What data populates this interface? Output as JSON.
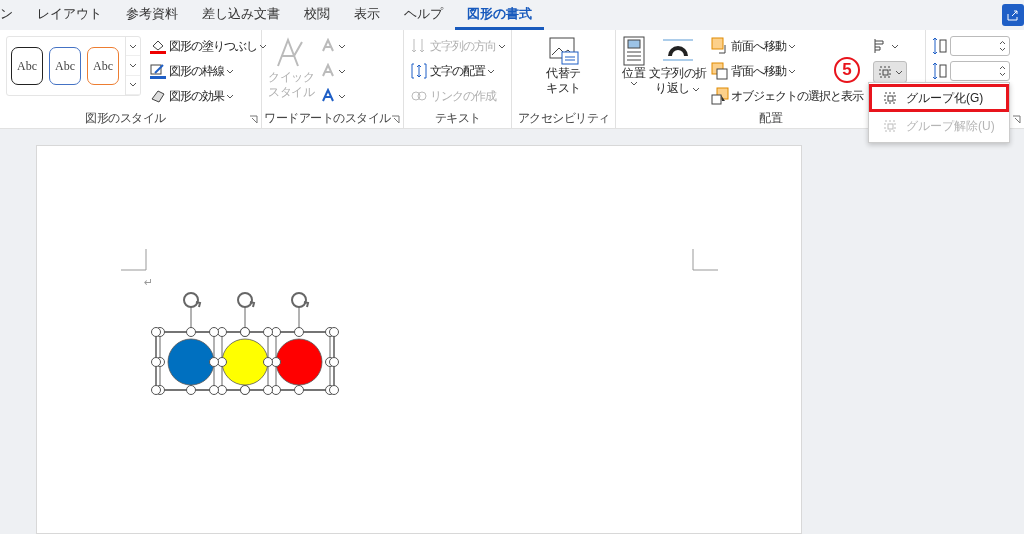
{
  "tabs": [
    {
      "label": "ン",
      "selected": false
    },
    {
      "label": "レイアウト",
      "selected": false
    },
    {
      "label": "参考資料",
      "selected": false
    },
    {
      "label": "差し込み文書",
      "selected": false
    },
    {
      "label": "校閲",
      "selected": false
    },
    {
      "label": "表示",
      "selected": false
    },
    {
      "label": "ヘルプ",
      "selected": false
    },
    {
      "label": "図形の書式",
      "selected": true
    }
  ],
  "shape_styles": {
    "gallery": [
      {
        "label": "Abc",
        "color": "#222222"
      },
      {
        "label": "Abc",
        "color": "#4472c4"
      },
      {
        "label": "Abc",
        "color": "#ed7d31"
      }
    ],
    "commands": [
      {
        "label": "図形の塗りつぶし",
        "kind": "fill",
        "disabled": false
      },
      {
        "label": "図形の枠線",
        "kind": "outline",
        "disabled": false
      },
      {
        "label": "図形の効果",
        "kind": "effects",
        "disabled": false
      }
    ],
    "label": "図形のスタイル"
  },
  "wordart": {
    "quick_style": {
      "line1": "クイック",
      "line2": "スタイル",
      "disabled": true
    },
    "label": "ワードアートのスタイル"
  },
  "text": {
    "commands": [
      {
        "label": "文字列の方向",
        "kind": "direction",
        "disabled": true
      },
      {
        "label": "文字の配置",
        "kind": "align",
        "disabled": false
      },
      {
        "label": "リンクの作成",
        "kind": "link",
        "disabled": true
      }
    ],
    "label": "テキスト"
  },
  "accessibility": {
    "button": {
      "line1": "代替テ",
      "line2": "キスト"
    },
    "label": "アクセシビリティ"
  },
  "arrange": {
    "position": {
      "label": "位置"
    },
    "wrap": {
      "line1": "文字列の折",
      "line2": "り返し"
    },
    "commands": [
      {
        "label": "前面へ移動",
        "kind": "front"
      },
      {
        "label": "背面へ移動",
        "kind": "back"
      },
      {
        "label": "オブジェクトの選択と表示",
        "kind": "pane"
      }
    ],
    "group_button": {
      "expanded": true
    },
    "label": "配置"
  },
  "annotation": {
    "label": "5"
  },
  "group_menu": [
    {
      "label": "グループ化(G)",
      "disabled": false,
      "highlighted": true
    },
    {
      "label": "グループ解除(U)",
      "disabled": true,
      "highlighted": false
    }
  ],
  "document": {
    "paragraph_mark": "↵",
    "shapes": [
      {
        "color": "#0070c0"
      },
      {
        "color": "#ffff00"
      },
      {
        "color": "#ff0000"
      }
    ],
    "selected": true
  }
}
